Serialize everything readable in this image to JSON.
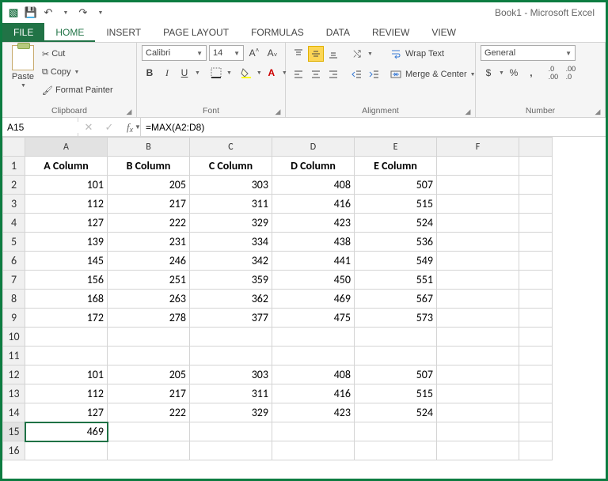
{
  "title": "Book1 - Microsoft Excel",
  "qat": {
    "excel": "X",
    "save": "💾",
    "undo": "↶",
    "redo": "↷"
  },
  "tabs": {
    "file": "FILE",
    "items": [
      "HOME",
      "INSERT",
      "PAGE LAYOUT",
      "FORMULAS",
      "DATA",
      "REVIEW",
      "VIEW"
    ],
    "active_index": 0
  },
  "ribbon": {
    "clipboard": {
      "paste": "Paste",
      "cut": "Cut",
      "copy": "Copy",
      "fmtpaint": "Format Painter",
      "label": "Clipboard"
    },
    "font": {
      "name": "Calibri",
      "size": "14",
      "bold": "B",
      "italic": "I",
      "underline": "U",
      "label": "Font"
    },
    "alignment": {
      "wrap": "Wrap Text",
      "merge": "Merge & Center",
      "label": "Alignment"
    },
    "number": {
      "format": "General",
      "currency": "$",
      "percent": "%",
      "comma": ",",
      "label": "Number"
    }
  },
  "formula_bar": {
    "cell_ref": "A15",
    "formula": "=MAX(A2:D8)"
  },
  "sheet": {
    "col_letters": [
      "A",
      "B",
      "C",
      "D",
      "E",
      "F",
      ""
    ],
    "headers": [
      "A Column",
      "B Column",
      "C Column",
      "D Column",
      "E Column",
      "",
      ""
    ],
    "rows": [
      [
        "101",
        "205",
        "303",
        "408",
        "507",
        "",
        ""
      ],
      [
        "112",
        "217",
        "311",
        "416",
        "515",
        "",
        ""
      ],
      [
        "127",
        "222",
        "329",
        "423",
        "524",
        "",
        ""
      ],
      [
        "139",
        "231",
        "334",
        "438",
        "536",
        "",
        ""
      ],
      [
        "145",
        "246",
        "342",
        "441",
        "549",
        "",
        ""
      ],
      [
        "156",
        "251",
        "359",
        "450",
        "551",
        "",
        ""
      ],
      [
        "168",
        "263",
        "362",
        "469",
        "567",
        "",
        ""
      ],
      [
        "172",
        "278",
        "377",
        "475",
        "573",
        "",
        ""
      ],
      [
        "",
        "",
        "",
        "",
        "",
        "",
        ""
      ],
      [
        "",
        "",
        "",
        "",
        "",
        "",
        ""
      ],
      [
        "101",
        "205",
        "303",
        "408",
        "507",
        "",
        ""
      ],
      [
        "112",
        "217",
        "311",
        "416",
        "515",
        "",
        ""
      ],
      [
        "127",
        "222",
        "329",
        "423",
        "524",
        "",
        ""
      ],
      [
        "469",
        "",
        "",
        "",
        "",
        "",
        ""
      ],
      [
        "",
        "",
        "",
        "",
        "",
        "",
        ""
      ]
    ],
    "selected": {
      "row": 15,
      "col": 0,
      "ref": "A15"
    }
  }
}
